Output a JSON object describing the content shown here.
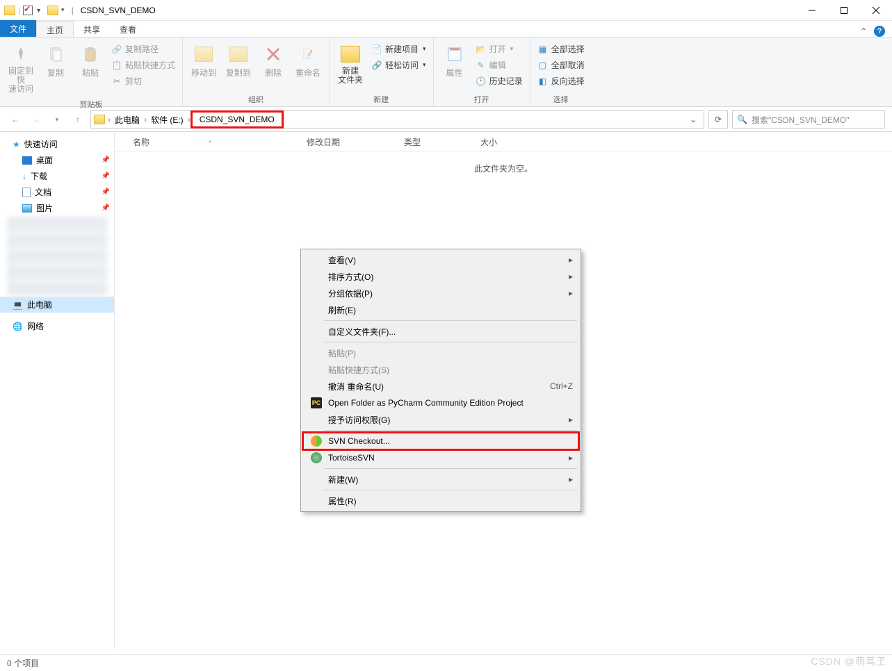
{
  "title": {
    "app": "CSDN_SVN_DEMO"
  },
  "tabs": {
    "file": "文件",
    "home": "主页",
    "share": "共享",
    "view": "查看"
  },
  "ribbon": {
    "clipboard": {
      "label": "剪贴板",
      "pin": "固定到快\n速访问",
      "copy": "复制",
      "paste": "粘贴",
      "copypath": "复制路径",
      "pasteshortcut": "粘贴快捷方式",
      "cut": "剪切"
    },
    "organize": {
      "label": "组织",
      "moveto": "移动到",
      "copyto": "复制到",
      "delete": "删除",
      "rename": "重命名"
    },
    "new": {
      "label": "新建",
      "newfolder": "新建\n文件夹",
      "newitem": "新建项目",
      "easyaccess": "轻松访问"
    },
    "open": {
      "label": "打开",
      "properties": "属性",
      "open": "打开",
      "edit": "编辑",
      "history": "历史记录"
    },
    "select": {
      "label": "选择",
      "selectall": "全部选择",
      "selectnone": "全部取消",
      "invert": "反向选择"
    }
  },
  "breadcrumb": {
    "pc": "此电脑",
    "drive": "软件 (E:)",
    "folder": "CSDN_SVN_DEMO"
  },
  "search": {
    "placeholder": "搜索\"CSDN_SVN_DEMO\""
  },
  "columns": {
    "name": "名称",
    "date": "修改日期",
    "type": "类型",
    "size": "大小"
  },
  "empty": "此文件夹为空。",
  "sidebar": {
    "quick": "快速访问",
    "desktop": "桌面",
    "downloads": "下载",
    "documents": "文档",
    "pictures": "图片",
    "thispc": "此电脑",
    "network": "网络"
  },
  "context": {
    "view": "查看(V)",
    "sort": "排序方式(O)",
    "group": "分组依据(P)",
    "refresh": "刷新(E)",
    "customize": "自定义文件夹(F)...",
    "paste": "粘贴(P)",
    "pastesc": "粘贴快捷方式(S)",
    "undo": "撤消 重命名(U)",
    "undo_short": "Ctrl+Z",
    "pycharm": "Open Folder as PyCharm Community Edition Project",
    "access": "授予访问权限(G)",
    "svncheckout": "SVN Checkout...",
    "tortoise": "TortoiseSVN",
    "new": "新建(W)",
    "props": "属性(R)"
  },
  "status": "0 个项目",
  "watermark": "CSDN @萌茑玊"
}
